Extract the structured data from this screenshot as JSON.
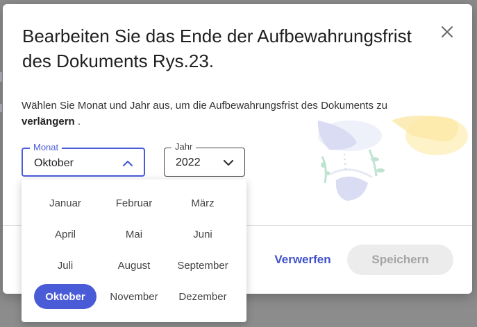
{
  "dialog": {
    "title": "Bearbeiten Sie das Ende der Aufbewahrungsfrist des Dokuments Rys.23.",
    "description_prefix": "Wählen Sie Monat und Jahr aus, um die Aufbewahrungsfrist des Dokuments zu ",
    "description_bold": "verlängern",
    "description_suffix": " .",
    "close_icon": "close-icon"
  },
  "month_field": {
    "label": "Monat",
    "value": "Oktober",
    "icon": "chevron-up-icon"
  },
  "year_field": {
    "label": "Jahr",
    "value": "2022",
    "icon": "chevron-down-icon"
  },
  "months": [
    "Januar",
    "Februar",
    "März",
    "April",
    "Mai",
    "Juni",
    "Juli",
    "August",
    "September",
    "Oktober",
    "November",
    "Dezember"
  ],
  "selected_month": "Oktober",
  "buttons": {
    "discard": "Verwerfen",
    "save": "Speichern"
  },
  "colors": {
    "accent": "#4a5bd8",
    "save_disabled_bg": "#ececec"
  }
}
